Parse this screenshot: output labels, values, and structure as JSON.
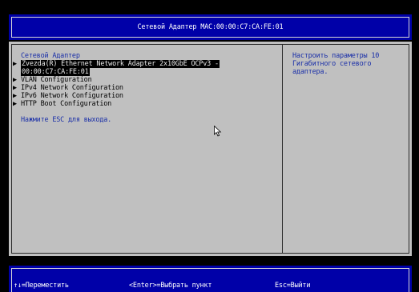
{
  "title": "Сетевой Адаптер MAC:00:00:C7:CA:FE:01",
  "menu": {
    "heading": "Сетевой Адаптер",
    "selected_line1": "Zvezda(R) Ethernet Network Adapter 2x10GbE OCPv3 -",
    "selected_line2": "00:00:C7:CA:FE:01",
    "items": [
      "VLAN Configuration",
      "IPv4 Network Configuration",
      "IPv6 Network Configuration",
      "HTTP Boot Configuration"
    ],
    "exit_hint": "Нажмите ESC для выхода."
  },
  "help": {
    "line1": "Настроить параметры 10",
    "line2": "Гигабитного сетевого",
    "line3": "адаптера."
  },
  "footer": {
    "move": "↑↓=Переместить",
    "select": "<Enter>=Выбрать пункт",
    "exit": "Esc=Выйти"
  },
  "colors": {
    "bar_bg": "#0000a8",
    "main_bg": "#c0c0c0",
    "accent_text": "#1a2fa8"
  },
  "icons": {
    "submenu": "triangle-right-icon",
    "pointer": "mouse-pointer-icon"
  }
}
